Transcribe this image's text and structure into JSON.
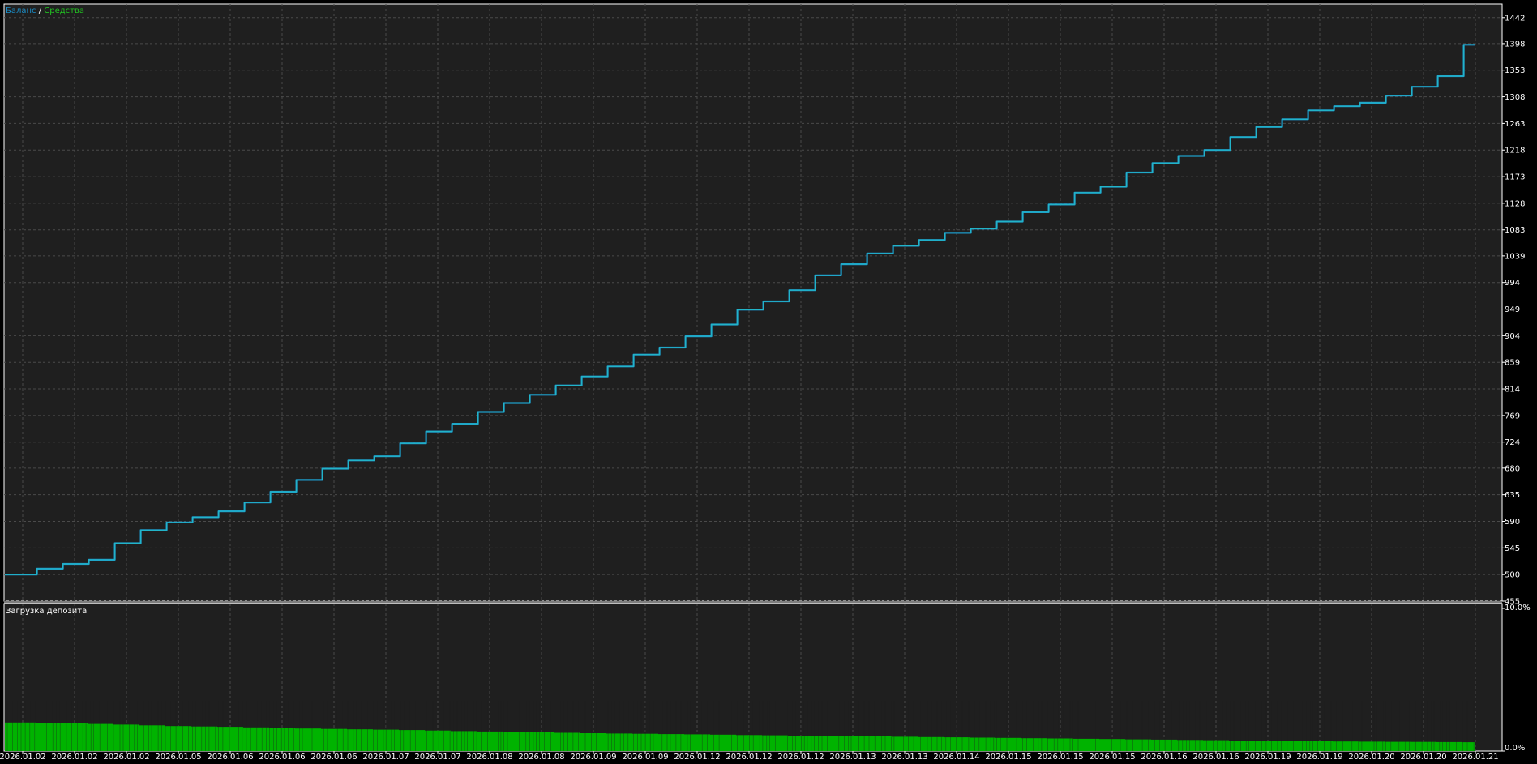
{
  "legend": {
    "balance_label": "Баланс",
    "separator": " / ",
    "equity_label": "Средства"
  },
  "subpanel": {
    "title": "Загрузка депозита"
  },
  "colors": {
    "background": "#1f1f1f",
    "frame": "#ffffff",
    "grid": "#4a4a4a",
    "balance": "#1b8ec8",
    "equity": "#22b4c8",
    "equity_legend": "#22c322",
    "load_bars": "#00b300",
    "text": "#ffffff"
  },
  "chart_data": [
    {
      "type": "line",
      "title": "",
      "xlabel": "",
      "ylabel": "",
      "ylim": [
        455,
        1465
      ],
      "grid": true,
      "legend": "top-left",
      "y_ticks": [
        455,
        500,
        545,
        590,
        635,
        680,
        724,
        769,
        814,
        859,
        904,
        949,
        994,
        1039,
        1083,
        1128,
        1173,
        1218,
        1263,
        1308,
        1353,
        1398,
        1442
      ],
      "x_ticks": [
        "2026.01.02",
        "2026.01.02",
        "2026.01.02",
        "2026.01.05",
        "2026.01.06",
        "2026.01.06",
        "2026.01.06",
        "2026.01.07",
        "2026.01.07",
        "2026.01.08",
        "2026.01.08",
        "2026.01.09",
        "2026.01.09",
        "2026.01.12",
        "2026.01.12",
        "2026.01.12",
        "2026.01.13",
        "2026.01.13",
        "2026.01.14",
        "2026.01.15",
        "2026.01.15",
        "2026.01.15",
        "2026.01.16",
        "2026.01.16",
        "2026.01.19",
        "2026.01.19",
        "2026.01.20",
        "2026.01.20",
        "2026.01.21"
      ],
      "x": [
        0,
        0.5,
        1,
        1.5,
        2,
        2.5,
        3,
        3.5,
        4,
        4.5,
        5,
        5.5,
        6,
        6.5,
        7,
        7.5,
        8,
        8.5,
        9,
        9.5,
        10,
        10.5,
        11,
        11.5,
        12,
        12.5,
        13,
        13.5,
        14,
        14.5,
        15,
        15.5,
        16,
        16.5,
        17,
        17.5,
        18,
        18.5,
        19,
        19.5,
        20,
        20.5,
        21,
        21.5,
        22,
        22.5,
        23,
        23.5,
        24,
        24.5,
        25,
        25.5,
        26,
        26.5,
        27,
        27.5,
        28
      ],
      "series": [
        {
          "name": "Баланс",
          "values": [
            500,
            510,
            518,
            525,
            553,
            575,
            588,
            597,
            607,
            622,
            640,
            660,
            679,
            693,
            700,
            722,
            742,
            755,
            775,
            790,
            804,
            820,
            835,
            852,
            872,
            884,
            903,
            923,
            948,
            962,
            981,
            1006,
            1025,
            1043,
            1056,
            1066,
            1078,
            1085,
            1097,
            1113,
            1126,
            1146,
            1156,
            1180,
            1196,
            1208,
            1218,
            1240,
            1257,
            1270,
            1285,
            1292,
            1298,
            1310,
            1325,
            1343,
            1396
          ]
        },
        {
          "name": "Средства",
          "values": [
            500,
            510,
            518,
            525,
            553,
            575,
            588,
            597,
            607,
            622,
            640,
            660,
            679,
            693,
            700,
            722,
            742,
            755,
            775,
            790,
            804,
            820,
            835,
            852,
            872,
            884,
            903,
            923,
            948,
            962,
            981,
            1006,
            1025,
            1043,
            1056,
            1066,
            1078,
            1085,
            1097,
            1113,
            1126,
            1146,
            1156,
            1180,
            1196,
            1208,
            1218,
            1240,
            1257,
            1270,
            1285,
            1292,
            1298,
            1310,
            1325,
            1343,
            1396
          ]
        }
      ]
    },
    {
      "type": "bar",
      "title": "Загрузка депозита",
      "ylim": [
        0,
        10
      ],
      "y_ticks": [
        "10.0%",
        "0.0%"
      ],
      "grid": true,
      "x": [
        0,
        0.5,
        1,
        1.5,
        2,
        2.5,
        3,
        3.5,
        4,
        4.5,
        5,
        5.5,
        6,
        6.5,
        7,
        7.5,
        8,
        8.5,
        9,
        9.5,
        10,
        10.5,
        11,
        11.5,
        12,
        12.5,
        13,
        13.5,
        14,
        14.5,
        15,
        15.5,
        16,
        16.5,
        17,
        17.5,
        18,
        18.5,
        19,
        19.5,
        20,
        20.5,
        21,
        21.5,
        22,
        22.5,
        23,
        23.5,
        24,
        24.5,
        25,
        25.5,
        26,
        26.5,
        27,
        27.5,
        28
      ],
      "values": [
        2.0,
        1.98,
        1.95,
        1.9,
        1.85,
        1.8,
        1.75,
        1.72,
        1.7,
        1.66,
        1.62,
        1.58,
        1.55,
        1.52,
        1.5,
        1.47,
        1.44,
        1.4,
        1.37,
        1.34,
        1.31,
        1.28,
        1.25,
        1.23,
        1.21,
        1.19,
        1.17,
        1.15,
        1.12,
        1.1,
        1.08,
        1.06,
        1.04,
        1.02,
        1.0,
        0.98,
        0.96,
        0.94,
        0.92,
        0.9,
        0.88,
        0.86,
        0.84,
        0.82,
        0.8,
        0.78,
        0.76,
        0.74,
        0.72,
        0.7,
        0.68,
        0.67,
        0.66,
        0.65,
        0.64,
        0.63,
        0.62
      ]
    }
  ]
}
